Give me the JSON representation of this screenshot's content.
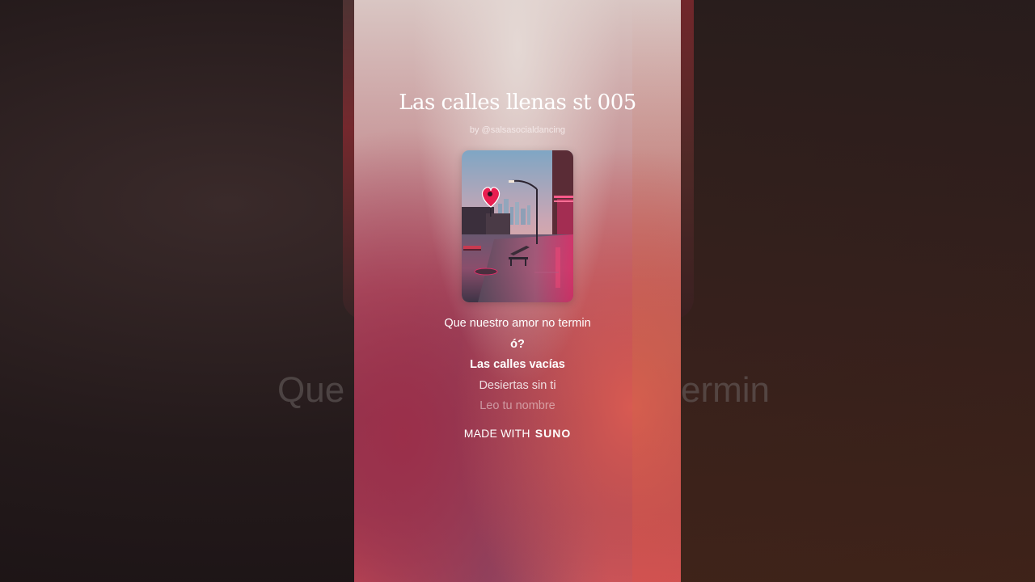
{
  "song": {
    "title": "Las calles llenas st 005",
    "artist_prefix": "by",
    "artist_handle": "@salsasocialdancing"
  },
  "cover_art": {
    "subject": "neon city street at dusk with heart-shaped sign and bench",
    "icon": "heart-sign-icon"
  },
  "lyrics": {
    "lines": [
      {
        "text": "Que nuestro amor no termin",
        "state": "past"
      },
      {
        "text": "ó?",
        "state": "active"
      },
      {
        "text": "Las calles vacías",
        "state": "active"
      },
      {
        "text": "Desiertas sin ti",
        "state": "upcoming"
      },
      {
        "text": "Leo tu nombre",
        "state": "upcoming-faded"
      }
    ]
  },
  "background_lyric": {
    "left": "Que",
    "right": "ermin"
  },
  "footer": {
    "made_with": "MADE WITH",
    "brand": "SUNO"
  },
  "colors": {
    "text": "#ffffff",
    "background": "#1a1214",
    "accent_pink": "#e0305a"
  }
}
